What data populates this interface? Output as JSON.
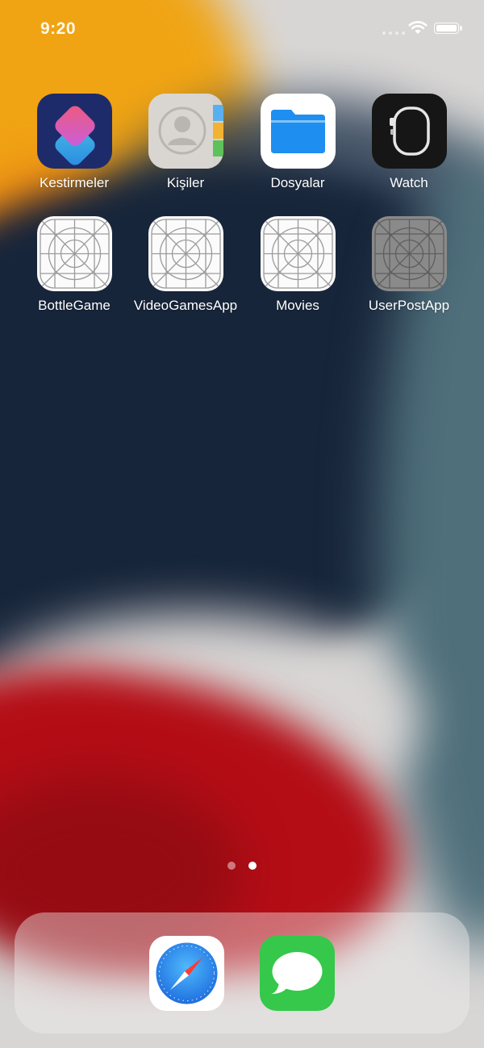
{
  "status_bar": {
    "time": "9:20",
    "icons": [
      "signal-icon",
      "wifi-icon",
      "battery-icon"
    ]
  },
  "home_screen": {
    "rows": [
      [
        {
          "label": "Kestirmeler",
          "icon": "shortcuts-icon"
        },
        {
          "label": "Kişiler",
          "icon": "contacts-icon"
        },
        {
          "label": "Dosyalar",
          "icon": "files-icon"
        },
        {
          "label": "Watch",
          "icon": "watch-icon"
        }
      ],
      [
        {
          "label": "BottleGame",
          "icon": "placeholder-app-icon"
        },
        {
          "label": "VideoGamesApp",
          "icon": "placeholder-app-icon"
        },
        {
          "label": "Movies",
          "icon": "placeholder-app-icon"
        },
        {
          "label": "UserPostApp",
          "icon": "placeholder-app-icon"
        }
      ]
    ]
  },
  "page_indicator": {
    "pages": 2,
    "current": 2
  },
  "dock": {
    "apps": [
      {
        "icon": "safari-icon"
      },
      {
        "icon": "messages-icon"
      }
    ]
  },
  "colors": {
    "shortcuts_bg": "#1e2b6b",
    "files_blue": "#1e8ff0",
    "watch_bg": "#161616",
    "messages_green": "#35c84a",
    "safari_blue": "#1f8cf0"
  }
}
